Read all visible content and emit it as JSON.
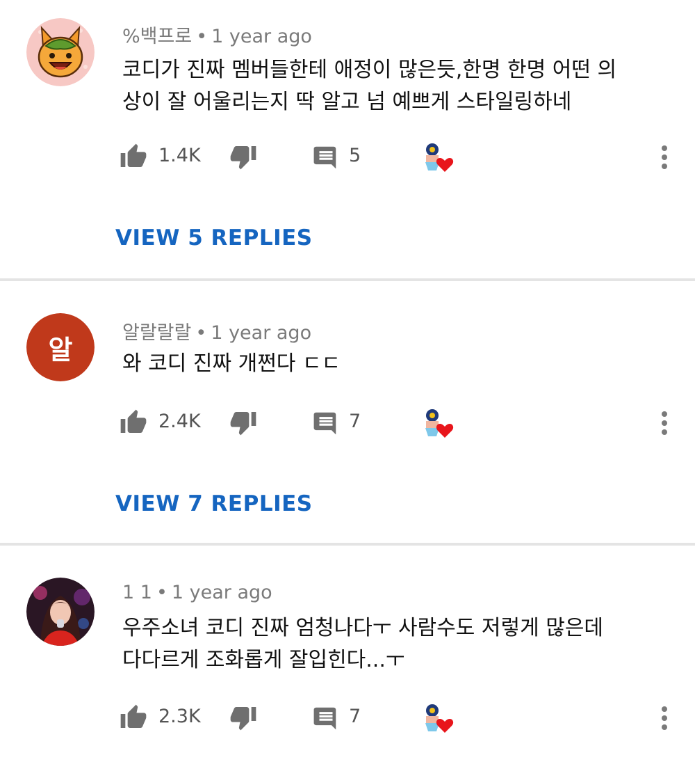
{
  "comments": [
    {
      "author": "%백프로",
      "separator": "•",
      "time": "1 year ago",
      "text_lines": [
        "코디가 진짜 멤버들한테 애정이 많은듯,한명 한명 어떤 의",
        "상이 잘 어울리는지 딱 알고 넘 예쁘게 스타일링하네"
      ],
      "likes": "1.4K",
      "reply_count": "5",
      "view_replies": "VIEW 5 REPLIES",
      "avatar": "cat-character"
    },
    {
      "author": "알랄랄랄",
      "separator": "•",
      "time": "1 year ago",
      "text_lines": [
        "와 코디 진짜 개쩐다 ㄷㄷ"
      ],
      "likes": "2.4K",
      "reply_count": "7",
      "view_replies": "VIEW 7 REPLIES",
      "avatar_letter": "알",
      "avatar_color": "#c0391b"
    },
    {
      "author": "1 1",
      "separator": "•",
      "time": "1 year ago",
      "text_lines": [
        "우주소녀 코디 진짜 엄청나다ㅜ 사람수도 저렇게 많은데",
        "다다르게 조화롭게 잘입힌다...ㅜ"
      ],
      "likes": "2.3K",
      "reply_count": "7",
      "avatar": "person-photo"
    }
  ],
  "icons": {
    "like": "thumb-up-icon",
    "dislike": "thumb-down-icon",
    "reply": "comment-icon",
    "creator_heart": "creator-heart-icon",
    "more": "more-vert-icon"
  },
  "colors": {
    "link": "#1565c0",
    "heart": "#e8151b",
    "divider": "#e4e4e4",
    "meta": "#7a7a7a"
  }
}
